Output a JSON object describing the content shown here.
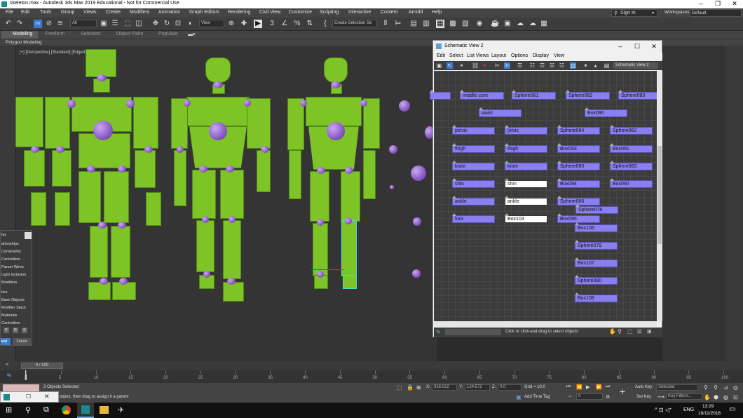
{
  "window": {
    "title": "skeleton.max - Autodesk 3ds Max 2019 Educational - Not for Commercial Use"
  },
  "menu": [
    "File",
    "Edit",
    "Tools",
    "Group",
    "Views",
    "Create",
    "Modifiers",
    "Animation",
    "Graph Editors",
    "Rendering",
    "Civil View",
    "Customize",
    "Scripting",
    "Interactive",
    "Content",
    "Arnold",
    "Help"
  ],
  "account": {
    "sign_in": "Sign In",
    "workspaces_label": "Workspaces:",
    "workspace": "Default"
  },
  "toolbar": {
    "filter": "All",
    "view": "View",
    "selection_set": "Create Selection Se",
    "snap_num": "3"
  },
  "ribbon": {
    "tabs": [
      "Modeling",
      "Freeform",
      "Selection",
      "Object Paint",
      "Populate"
    ],
    "sub": "Polygon Modeling"
  },
  "viewport": {
    "label": "[+] [Perspective] [Standard] [Edged Faces]"
  },
  "popup": {
    "title": "lay",
    "items": [
      "ationships",
      "Constraints",
      "Controllers",
      "Param Wires",
      "Light Inclusion",
      "Modifiers",
      "ties",
      "Base Objects",
      "Modifier Stack",
      "Materials",
      "Controllers"
    ],
    "letters": [
      "P",
      "R",
      "S"
    ],
    "btn1": "and",
    "btn2": "Focus"
  },
  "schematic": {
    "title": "Schematic View 2",
    "menu": [
      "Edit",
      "Select",
      "List Views",
      "Layout",
      "Options",
      "Display",
      "View"
    ],
    "view_field": "Schematic View 2",
    "status": "Click or click-and-drag to select objects",
    "nodes": [
      "middle core",
      "Sphere081",
      "Sphere082",
      "Sphere083",
      "waist",
      "Box090",
      "pelvic",
      "[elvic",
      "Sphere064",
      "Sphere062",
      "thigh",
      "thigh",
      "Box093",
      "Box091",
      "knee",
      "knee",
      "Sphere065",
      "Sphere063",
      "shin",
      "shin",
      "Box094",
      "Box092",
      "ankle",
      "ankle",
      "Sphere066",
      "Sphere078",
      "foot",
      "Box103",
      "Box095",
      "Box106",
      "Sphere079",
      "Box107",
      "Sphere080",
      "Box108"
    ]
  },
  "timeline": {
    "frame": "0 / 100",
    "ticks": [
      "0",
      "5",
      "10",
      "15",
      "20",
      "25",
      "30",
      "35",
      "40",
      "45",
      "50",
      "55",
      "60",
      "65",
      "70",
      "75",
      "80",
      "85",
      "90",
      "95",
      "100"
    ]
  },
  "status": {
    "selected": "3 Objects Selected",
    "prompt": "elect an object, then drag to assign it a parent",
    "x_label": "X:",
    "x_val": "316.022",
    "y_label": "Y:",
    "y_val": "124.572",
    "z_label": "Z:",
    "z_val": "0.0",
    "grid": "Grid = 10.0",
    "add_time_tag": "Add Time Tag",
    "frame_val": "0",
    "auto_key": "Auto Key",
    "set_key": "Set Key",
    "key_mode": "Selected",
    "key_filters": "Key Filters..."
  },
  "taskbar": {
    "lang": "ENG",
    "time": "13:29",
    "date": "19/11/2018"
  }
}
